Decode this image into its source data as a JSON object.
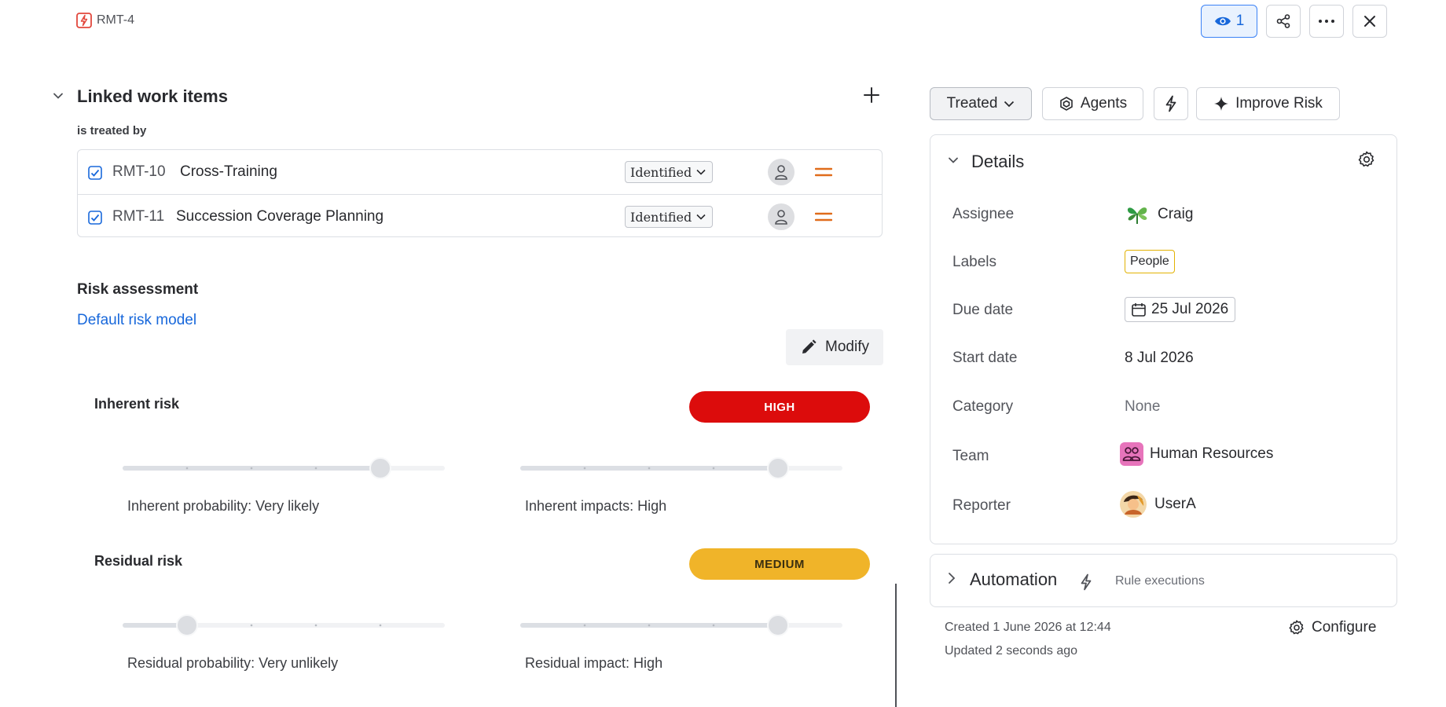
{
  "header": {
    "issue_key": "RMT-4",
    "watch_count": "1"
  },
  "linked": {
    "title": "Linked work items",
    "relation": "is treated by",
    "items": [
      {
        "key": "RMT-10",
        "summary": "Cross-Training",
        "status": "Identified"
      },
      {
        "key": "RMT-11",
        "summary": "Succession Coverage Planning",
        "status": "Identified"
      }
    ]
  },
  "risk": {
    "title": "Risk assessment",
    "model_link": "Default risk model",
    "modify_label": "Modify",
    "inherent": {
      "label": "Inherent risk",
      "level": "HIGH",
      "level_color": "#dc0c0c",
      "probability_caption": "Inherent probability: Very likely",
      "probability_level": 4,
      "impact_caption": "Inherent impacts: High",
      "impact_level": 4
    },
    "residual": {
      "label": "Residual risk",
      "level": "MEDIUM",
      "level_color": "#f0b429",
      "probability_caption": "Residual probability: Very unlikely",
      "probability_level": 1,
      "impact_caption": "Residual impact: High",
      "impact_level": 4
    },
    "scale_steps": 5
  },
  "toolbar": {
    "status": "Treated",
    "agents": "Agents",
    "improve": "Improve Risk"
  },
  "details": {
    "title": "Details",
    "fields": {
      "assignee": {
        "label": "Assignee",
        "value": "Craig"
      },
      "labels": {
        "label": "Labels",
        "value": "People"
      },
      "due_date": {
        "label": "Due date",
        "value": "25 Jul 2026"
      },
      "start_date": {
        "label": "Start date",
        "value": "8 Jul 2026"
      },
      "category": {
        "label": "Category",
        "value": "None"
      },
      "team": {
        "label": "Team",
        "value": "Human Resources"
      },
      "reporter": {
        "label": "Reporter",
        "value": "UserA"
      }
    }
  },
  "automation": {
    "title": "Automation",
    "subtitle": "Rule executions"
  },
  "meta": {
    "created": "Created 1 June 2026 at 12:44",
    "updated": "Updated 2 seconds ago",
    "configure": "Configure"
  },
  "icons": [
    "lightning-issue-icon",
    "eye-icon",
    "share-icon",
    "ellipsis-icon",
    "close-icon",
    "chevron-down-icon",
    "plus-icon",
    "checkbox-icon",
    "user-placeholder-icon",
    "priority-medium-icon",
    "pencil-icon",
    "agents-icon",
    "bolt-icon",
    "sparkle-icon",
    "gear-icon",
    "calendar-icon",
    "team-icon",
    "chevron-right-icon"
  ],
  "colors": {
    "accent": "#1868db",
    "priority_medium": "#e06c1b"
  }
}
